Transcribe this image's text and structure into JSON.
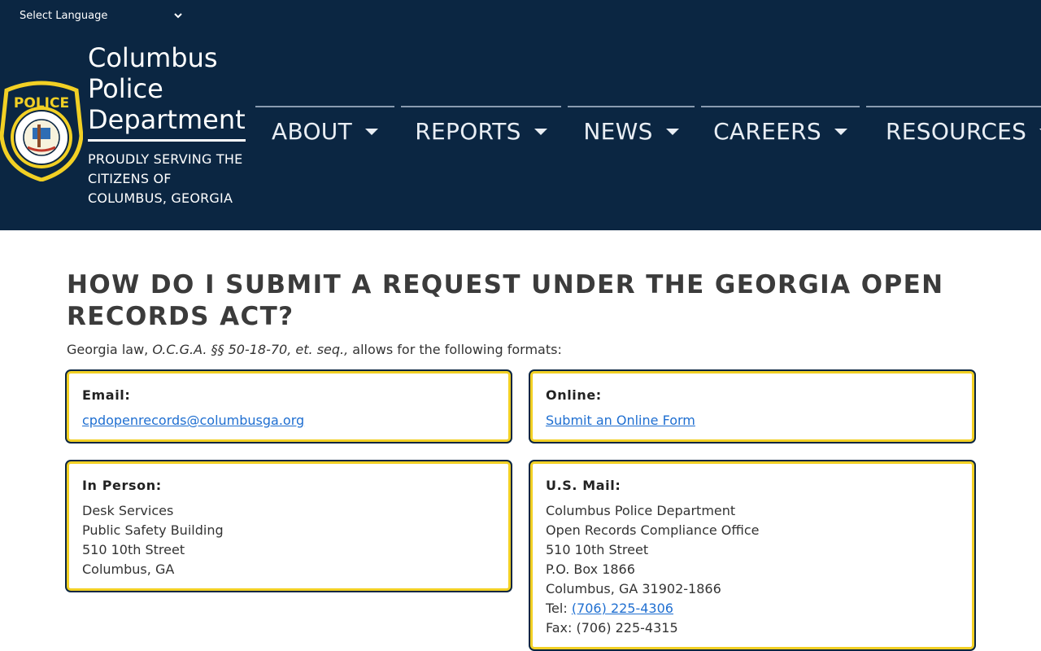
{
  "language_selector": {
    "label": "Select Language",
    "icon": "chevron-down-icon"
  },
  "brand": {
    "title_lines": [
      "Columbus",
      "Police",
      "Department"
    ],
    "tagline_lines": [
      "PROUDLY SERVING THE",
      "CITIZENS OF",
      "COLUMBUS, GEORGIA"
    ],
    "badge": {
      "top_text": "POLICE",
      "ring_text": "COLUMBUS, GEORGIA • CONSOLIDATED GOVERNMENT",
      "colors": {
        "navy": "#0b2642",
        "gold": "#f2d024"
      }
    }
  },
  "nav": [
    {
      "label": "ABOUT",
      "icon": "caret-down-icon"
    },
    {
      "label": "REPORTS",
      "icon": "caret-down-icon"
    },
    {
      "label": "NEWS",
      "icon": "caret-down-icon"
    },
    {
      "label": "CAREERS",
      "icon": "caret-down-icon"
    },
    {
      "label": "RESOURCES",
      "icon": "caret-down-icon"
    }
  ],
  "page": {
    "heading": "HOW DO I SUBMIT A REQUEST UNDER THE GEORGIA OPEN RECORDS ACT?",
    "intro_before": "Georgia law, ",
    "intro_citation": "O.C.G.A. §§ 50-18-70, et. seq.,",
    "intro_after": " allows for the following formats:"
  },
  "cards": {
    "email": {
      "label": "Email:",
      "link_text": "cpdopenrecords@columbusga.org"
    },
    "online": {
      "label": "Online:",
      "link_text": "Submit an Online Form"
    },
    "in_person": {
      "label": "In Person:",
      "lines": [
        "Desk Services",
        "Public Safety Building",
        "510 10th Street",
        "Columbus, GA"
      ]
    },
    "mail": {
      "label": "U.S. Mail:",
      "lines": [
        "Columbus Police Department",
        "Open Records Compliance Office",
        "510 10th Street",
        "P.O. Box 1866",
        "Columbus, GA 31902-1866"
      ],
      "tel_label": "Tel: ",
      "tel_number": "(706) 225-4306",
      "fax_line": "Fax: (706) 225-4315"
    }
  },
  "colors": {
    "header_bg": "#0b2642",
    "card_border": "#f2d024",
    "link": "#1f6fd1",
    "heading": "#3b3b3b"
  }
}
